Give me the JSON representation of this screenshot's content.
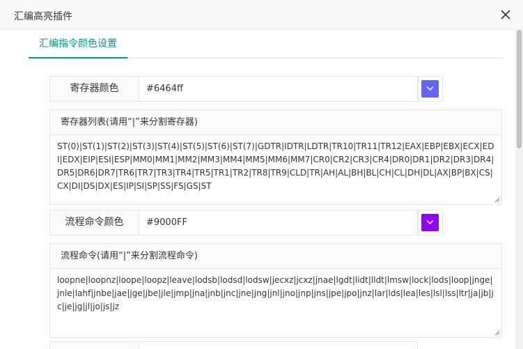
{
  "dialog": {
    "title": "汇编高亮插件",
    "close_icon": "close-icon"
  },
  "tabs": [
    {
      "label": "汇编指令颜色设置",
      "active": true
    }
  ],
  "register_color": {
    "label": "寄存器颜色",
    "value": "#6464ff",
    "swatch_color": "#6464ff",
    "icon": "chevron-down-icon"
  },
  "register_list": {
    "label": "寄存器列表(请用“|”来分割寄存器)",
    "value": "ST(0)|ST(1)|ST(2)|ST(3)|ST(4)|ST(5)|ST(6)|ST(7)|GDTR|IDTR|LDTR|TR10|TR11|TR12|EAX|EBP|EBX|ECX|EDI|EDX|EIP|ESI|ESP|MM0|MM1|MM2|MM3|MM4|MM5|MM6|MM7|CR0|CR2|CR3|CR4|DR0|DR1|DR2|DR3|DR4|DR5|DR6|DR7|TR6|TR7|TR3|TR4|TR5|TR1|TR2|TR8|TR9|CLD|TR|AH|AL|BH|BL|CH|CL|DH|DL|AX|BP|BX|CS|CX|DI|DS|DX|ES|IP|SI|SP|SS|FS|GS|ST"
  },
  "flow_color": {
    "label": "流程命令颜色",
    "value": "#9000FF",
    "swatch_color": "#9000ff",
    "icon": "chevron-down-icon"
  },
  "flow_list": {
    "label": "流程命令(请用“|”来分割流程命令)",
    "value": "loopne|loopnz|loope|loopz|leave|lodsb|lodsd|lodsw|jecxz|jcxz|jnae|lgdt|lidt|lldt|lmsw|lock|lods|loop|jnge|jnle|lahf|jnbe|jae|jge|jbe|jle|jmp|jna|jnb|jnc|jne|jng|jnl|jno|jnp|jns|jpe|jpo|jnz|lar|lds|lea|les|lsl|lss|ltr|ja|jb|jc|je|jg|jl|jo|js|jz"
  }
}
